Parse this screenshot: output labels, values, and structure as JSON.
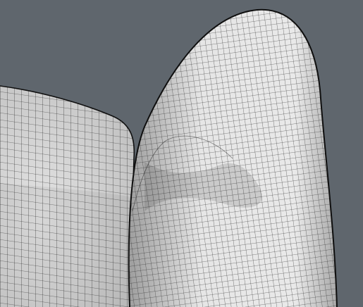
{
  "scene": {
    "background_color": "#5f666d",
    "mesh_face_color": "#d9d9d9",
    "mesh_line_color": "#1a1a1a",
    "objects": [
      "rounded-box-mesh",
      "leaf-shaped-sculpt-mesh"
    ]
  }
}
